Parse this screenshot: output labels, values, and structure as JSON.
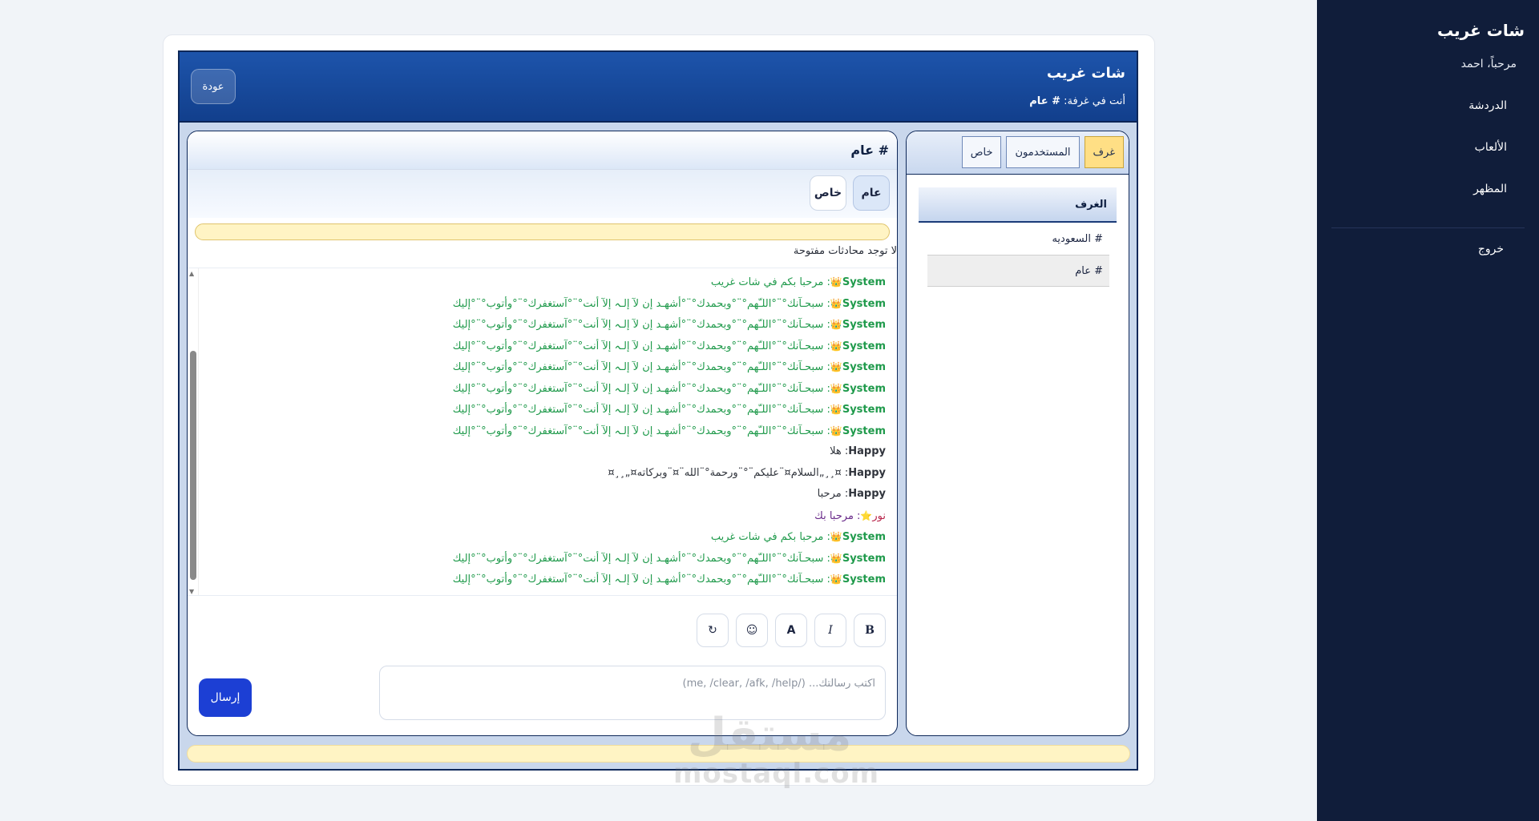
{
  "sidebar": {
    "app_title": "شات غريب",
    "welcome": "مرحباً، احمد",
    "items": [
      {
        "label": "الدردشة"
      },
      {
        "label": "الألعاب"
      },
      {
        "label": "المظهر"
      }
    ],
    "logout": "خروج"
  },
  "topbar": {
    "title": "شات غريب",
    "room_prefix": "أنت في غرفة:",
    "room_name": "# عام",
    "back_label": "عودة"
  },
  "rooms_panel": {
    "tabs": [
      {
        "label": "غرف",
        "active": true
      },
      {
        "label": "المستخدمون",
        "active": false
      },
      {
        "label": "خاص",
        "active": false
      }
    ],
    "header": "الغرف",
    "rooms": [
      {
        "label": "# السعوديه",
        "active": false
      },
      {
        "label": "# عام",
        "active": true
      }
    ]
  },
  "chat": {
    "header": "# عام",
    "subtabs": [
      {
        "label": "عام",
        "active": true
      },
      {
        "label": "خاص",
        "active": false
      }
    ],
    "no_conversations": "لا توجد محادثات مفتوحة",
    "messages": [
      {
        "type": "system",
        "sender": "System",
        "crown": "👑",
        "text": ": مرحبا بكم في شات غريب"
      },
      {
        "type": "system",
        "sender": "System",
        "crown": "👑",
        "text": ": سبحـآنك°¨°اللـّهم°¨°وبحمدك°¨°أشهـد إن لآ إلـہ إلآ أنت°¨°آستغفرك°¨°وأتوب°¨°إليك"
      },
      {
        "type": "system",
        "sender": "System",
        "crown": "👑",
        "text": ": سبحـآنك°¨°اللـّهم°¨°وبحمدك°¨°أشهـد إن لآ إلـہ إلآ أنت°¨°آستغفرك°¨°وأتوب°¨°إليك"
      },
      {
        "type": "system",
        "sender": "System",
        "crown": "👑",
        "text": ": سبحـآنك°¨°اللـّهم°¨°وبحمدك°¨°أشهـد إن لآ إلـہ إلآ أنت°¨°آستغفرك°¨°وأتوب°¨°إليك"
      },
      {
        "type": "system",
        "sender": "System",
        "crown": "👑",
        "text": ": سبحـآنك°¨°اللـّهم°¨°وبحمدك°¨°أشهـد إن لآ إلـہ إلآ أنت°¨°آستغفرك°¨°وأتوب°¨°إليك"
      },
      {
        "type": "system",
        "sender": "System",
        "crown": "👑",
        "text": ": سبحـآنك°¨°اللـّهم°¨°وبحمدك°¨°أشهـد إن لآ إلـہ إلآ أنت°¨°آستغفرك°¨°وأتوب°¨°إليك"
      },
      {
        "type": "system",
        "sender": "System",
        "crown": "👑",
        "text": ": سبحـآنك°¨°اللـّهم°¨°وبحمدك°¨°أشهـد إن لآ إلـہ إلآ أنت°¨°آستغفرك°¨°وأتوب°¨°إليك"
      },
      {
        "type": "system",
        "sender": "System",
        "crown": "👑",
        "text": ": سبحـآنك°¨°اللـّهم°¨°وبحمدك°¨°أشهـد إن لآ إلـہ إلآ أنت°¨°آستغفرك°¨°وأتوب°¨°إليك"
      },
      {
        "type": "user",
        "sender": "Happy",
        "crown": "",
        "text": ": هلا"
      },
      {
        "type": "user",
        "sender": "Happy",
        "crown": "",
        "text": ": ¤¸¸„السلام¤¨عليكم¨°¨ورحمة°¨الله¨¤¨وبركاته¤„¸¸¤"
      },
      {
        "type": "user",
        "sender": "Happy",
        "crown": "",
        "text": ": مرحبا"
      },
      {
        "type": "special",
        "sender": "نور",
        "crown": "⭐",
        "text": ": مرحبا بك"
      },
      {
        "type": "system",
        "sender": "System",
        "crown": "👑",
        "text": ": مرحبا بكم في شات غريب"
      },
      {
        "type": "system",
        "sender": "System",
        "crown": "👑",
        "text": ": سبحـآنك°¨°اللـّهم°¨°وبحمدك°¨°أشهـد إن لآ إلـہ إلآ أنت°¨°آستغفرك°¨°وأتوب°¨°إليك"
      },
      {
        "type": "system",
        "sender": "System",
        "crown": "👑",
        "text": ": سبحـآنك°¨°اللـّهم°¨°وبحمدك°¨°أشهـد إن لآ إلـہ إلآ أنت°¨°آستغفرك°¨°وأتوب°¨°إليك"
      }
    ],
    "toolbar": {
      "bold": "B",
      "italic": "I",
      "color": "A",
      "emoji": "☺",
      "refresh": "↻"
    },
    "input_placeholder": "اكتب رسالتك... (/me, /clear, /afk, /help)",
    "send_label": "إرسال"
  },
  "watermark": {
    "arabic": "مستقل",
    "latin": "mostaql.com"
  },
  "colors": {
    "sidebar_bg": "#101d3a",
    "topbar_bg": "#1d54ab",
    "send_button": "#1c3fd4",
    "system_message": "#1f9a4b",
    "active_tab": "#ffdf85"
  }
}
